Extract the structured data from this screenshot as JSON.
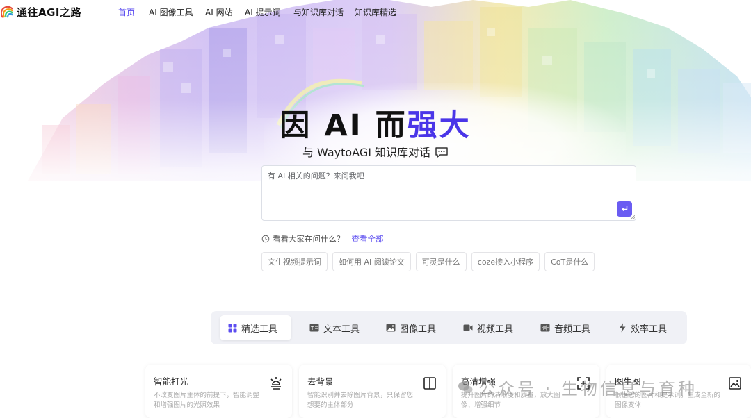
{
  "app": {
    "logo_text": "通往AGI之路"
  },
  "nav": {
    "items": [
      {
        "label": "首页",
        "active": true
      },
      {
        "label": "AI 图像工具",
        "active": false
      },
      {
        "label": "AI 网站",
        "active": false
      },
      {
        "label": "AI 提示词",
        "active": false
      },
      {
        "label": "与知识库对话",
        "active": false
      },
      {
        "label": "知识库精选",
        "active": false
      }
    ]
  },
  "hero": {
    "headline_main": "因 AI 而",
    "headline_accent": "强大",
    "subline": "与 WaytoAGI 知识库对话"
  },
  "question": {
    "placeholder": "有 AI 相关的问题？来问我吧",
    "send_icon": "enter-icon"
  },
  "popular": {
    "label": "看看大家在问什么？",
    "view_all": "查看全部",
    "chips": [
      "文生视频提示词",
      "如何用 AI 阅读论文",
      "可灵是什么",
      "coze接入小程序",
      "CoT是什么"
    ]
  },
  "tools": {
    "tabs": [
      {
        "label": "精选工具",
        "icon": "grid-icon",
        "active": true
      },
      {
        "label": "文本工具",
        "icon": "text-icon",
        "active": false
      },
      {
        "label": "图像工具",
        "icon": "image-icon",
        "active": false
      },
      {
        "label": "视频工具",
        "icon": "video-icon",
        "active": false
      },
      {
        "label": "音频工具",
        "icon": "audio-icon",
        "active": false
      },
      {
        "label": "效率工具",
        "icon": "lightning-icon",
        "active": false
      }
    ],
    "cards": [
      {
        "title": "智能打光",
        "desc": "不改变图片主体的前提下，智能调整和增强图片的光照效果",
        "icon": "lamp-icon"
      },
      {
        "title": "去背景",
        "desc": "智能识别并去除图片背景，只保留您想要的主体部分",
        "icon": "split-icon"
      },
      {
        "title": "高清增强",
        "desc": "提升图片的清晰度和质量，放大图像、增强细节",
        "icon": "focus-icon"
      },
      {
        "title": "图生图",
        "desc": "根据您的图片和提示词，生成全新的图像变体",
        "icon": "picture-icon"
      }
    ]
  },
  "watermark": {
    "text": "公众号 · 生物信息与育种"
  },
  "colors": {
    "accent": "#5b4cf0",
    "highlight": "#f6c72a",
    "send": "#6a5cf2"
  }
}
